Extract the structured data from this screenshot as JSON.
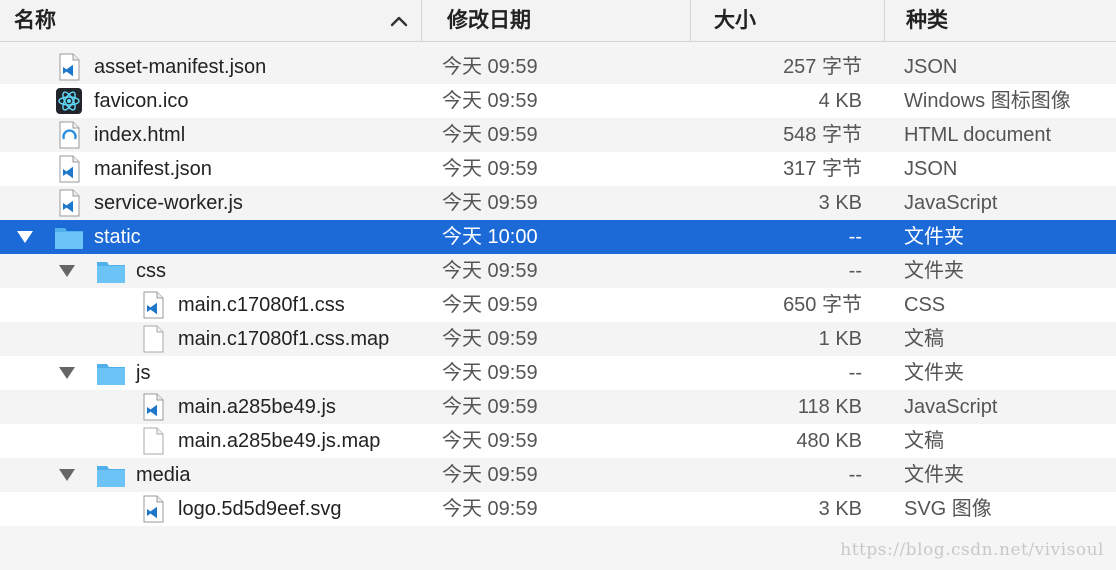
{
  "header": {
    "name": "名称",
    "date": "修改日期",
    "size": "大小",
    "kind": "种类",
    "sort": "ascending"
  },
  "colors": {
    "selection": "#1b6ad8",
    "folder": "#6cc3f5",
    "vscode": "#1e77c8",
    "react": "#61dafb"
  },
  "rows": [
    {
      "name": "asset-manifest.json",
      "date": "今天 09:59",
      "size": "257 字节",
      "kind": "JSON",
      "icon": "vscode-file-icon",
      "depth": 0
    },
    {
      "name": "favicon.ico",
      "date": "今天 09:59",
      "size": "4 KB",
      "kind": "Windows 图标图像",
      "icon": "react-logo-icon",
      "depth": 0
    },
    {
      "name": "index.html",
      "date": "今天 09:59",
      "size": "548 字节",
      "kind": "HTML document",
      "icon": "html-file-icon",
      "depth": 0
    },
    {
      "name": "manifest.json",
      "date": "今天 09:59",
      "size": "317 字节",
      "kind": "JSON",
      "icon": "vscode-file-icon",
      "depth": 0
    },
    {
      "name": "service-worker.js",
      "date": "今天 09:59",
      "size": "3 KB",
      "kind": "JavaScript",
      "icon": "vscode-file-icon",
      "depth": 0
    },
    {
      "name": "static",
      "date": "今天 10:00",
      "size": "--",
      "kind": "文件夹",
      "icon": "folder-icon",
      "depth": 0,
      "expanded": true,
      "selected": true
    },
    {
      "name": "css",
      "date": "今天 09:59",
      "size": "--",
      "kind": "文件夹",
      "icon": "folder-icon",
      "depth": 1,
      "expanded": true
    },
    {
      "name": "main.c17080f1.css",
      "date": "今天 09:59",
      "size": "650 字节",
      "kind": "CSS",
      "icon": "vscode-file-icon",
      "depth": 2
    },
    {
      "name": "main.c17080f1.css.map",
      "date": "今天 09:59",
      "size": "1 KB",
      "kind": "文稿",
      "icon": "blank-document-icon",
      "depth": 2
    },
    {
      "name": "js",
      "date": "今天 09:59",
      "size": "--",
      "kind": "文件夹",
      "icon": "folder-icon",
      "depth": 1,
      "expanded": true
    },
    {
      "name": "main.a285be49.js",
      "date": "今天 09:59",
      "size": "118 KB",
      "kind": "JavaScript",
      "icon": "vscode-file-icon",
      "depth": 2
    },
    {
      "name": "main.a285be49.js.map",
      "date": "今天 09:59",
      "size": "480 KB",
      "kind": "文稿",
      "icon": "blank-document-icon",
      "depth": 2
    },
    {
      "name": "media",
      "date": "今天 09:59",
      "size": "--",
      "kind": "文件夹",
      "icon": "folder-icon",
      "depth": 1,
      "expanded": true
    },
    {
      "name": "logo.5d5d9eef.svg",
      "date": "今天 09:59",
      "size": "3 KB",
      "kind": "SVG 图像",
      "icon": "vscode-file-icon",
      "depth": 2
    }
  ],
  "watermark": "https://blog.csdn.net/vivisoul"
}
